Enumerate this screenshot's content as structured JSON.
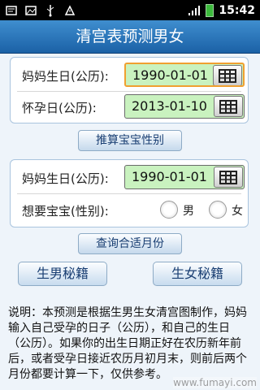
{
  "status_bar": {
    "time": "15:42"
  },
  "app": {
    "title": "清宫表预测男女"
  },
  "section1": {
    "mother_birth_label": "妈妈生日(公历):",
    "mother_birth_value": "1990-01-01",
    "pregnancy_label": "怀孕日(公历):",
    "pregnancy_value": "2013-01-10",
    "calc_button": "推算宝宝性别"
  },
  "section2": {
    "mother_birth_label": "妈妈生日(公历):",
    "mother_birth_value": "1990-01-01",
    "desired_gender_label": "想要宝宝(性别):",
    "option_male": "男",
    "option_female": "女",
    "query_button": "查询合适月份"
  },
  "buttons": {
    "boy_tips": "生男秘籍",
    "girl_tips": "生女秘籍"
  },
  "description": "说明：本预测是根据生男生女清宫图制作，妈妈输入自己受孕的日子（公历），和自己的生日（公历）。如果你的出生日期正好在农历新年前后，或者受孕日接近农历月初月末，则前后两个月份都要计算一下，仅供参考。",
  "watermark": "www.fumayi.com"
}
